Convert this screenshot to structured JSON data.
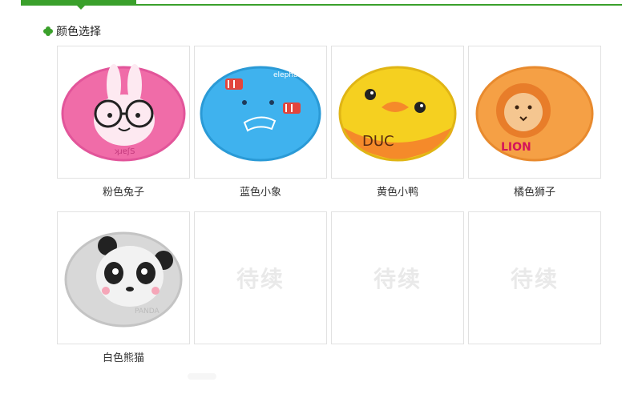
{
  "section": {
    "title": "颜色选择",
    "icon": "clover-icon",
    "accent": "#3aa02b"
  },
  "items": [
    {
      "label": "粉色兔子",
      "icon": "pink-rabbit-cap-image",
      "color": "#f06ca8",
      "art_text": "ʞɹɐʃS"
    },
    {
      "label": "蓝色小象",
      "icon": "blue-elephant-cap-image",
      "color": "#3fb2ee",
      "art_text": "elephant"
    },
    {
      "label": "黄色小鸭",
      "icon": "yellow-duck-cap-image",
      "color": "#f5d020",
      "art_text": "DUC"
    },
    {
      "label": "橘色狮子",
      "icon": "orange-lion-cap-image",
      "color": "#f5a045",
      "art_text": "LION"
    },
    {
      "label": "白色熊猫",
      "icon": "white-panda-cap-image",
      "color": "#d8d8d8",
      "art_text": "PANDA"
    }
  ],
  "placeholder_text": "待续"
}
